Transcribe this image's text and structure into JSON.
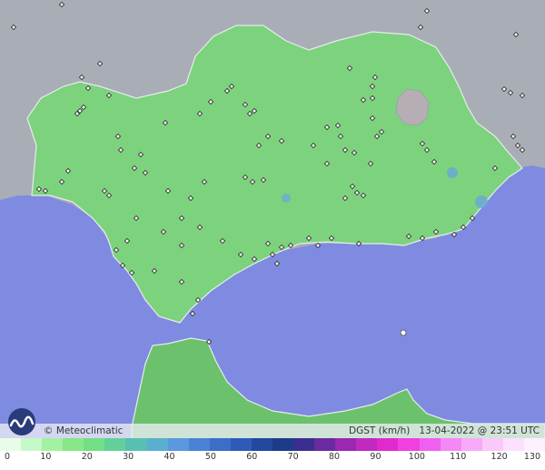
{
  "map": {
    "credit": "© Meteoclimatic",
    "variable": "DGST (km/h)",
    "datetime": "13-04-2022 @ 23:51 UTC",
    "colors": {
      "sea": "#7f8be0",
      "land_outside": "#a9adb6",
      "region_fill": "#7dd27d",
      "north_africa_fill": "#6cc16c",
      "station_marker": "#222222"
    }
  },
  "scale": {
    "ticks": [
      "0",
      "10",
      "20",
      "30",
      "40",
      "50",
      "60",
      "70",
      "80",
      "90",
      "100",
      "110",
      "120",
      "130"
    ],
    "colors": [
      "#e8fde8",
      "#c7f8c7",
      "#a3f1a3",
      "#86e886",
      "#72de86",
      "#63d09a",
      "#58c0b0",
      "#5aaed0",
      "#5b98e0",
      "#4a82d8",
      "#3b6ec8",
      "#2f5ab8",
      "#2448a0",
      "#1c3c88",
      "#3a2e90",
      "#6a2aa0",
      "#9a28b0",
      "#c02ac0",
      "#e02ad0",
      "#f040e0",
      "#f060f0",
      "#f488f4",
      "#f8aaf8",
      "#fbc8fb",
      "#fde0fd",
      "#fff0ff"
    ]
  }
}
